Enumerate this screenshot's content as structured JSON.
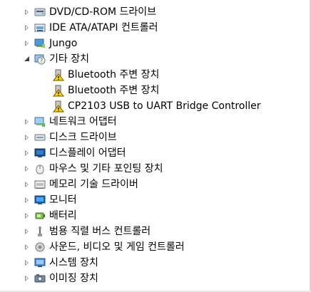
{
  "tree": {
    "items": [
      {
        "label": "DVD/CD-ROM 드라이브",
        "icon": "dvd-drive-icon",
        "state": "collapsed"
      },
      {
        "label": "IDE ATA/ATAPI 컨트롤러",
        "icon": "ide-controller-icon",
        "state": "collapsed"
      },
      {
        "label": "Jungo",
        "icon": "jungo-device-icon",
        "state": "collapsed"
      },
      {
        "label": "기타 장치",
        "icon": "unknown-device-icon",
        "state": "expanded"
      },
      {
        "label": "Bluetooth 주변 장치",
        "icon": "warning-device-icon",
        "state": "leaf"
      },
      {
        "label": "Bluetooth 주변 장치",
        "icon": "warning-device-icon",
        "state": "leaf"
      },
      {
        "label": "CP2103 USB to UART Bridge Controller",
        "icon": "warning-device-icon",
        "state": "leaf"
      },
      {
        "label": "네트워크 어댑터",
        "icon": "network-adapter-icon",
        "state": "collapsed"
      },
      {
        "label": "디스크 드라이브",
        "icon": "disk-drive-icon",
        "state": "collapsed"
      },
      {
        "label": "디스플레이 어댑터",
        "icon": "display-adapter-icon",
        "state": "collapsed"
      },
      {
        "label": "마우스 및 기타 포인팅 장치",
        "icon": "mouse-icon",
        "state": "collapsed"
      },
      {
        "label": "메모리 기술 드라이버",
        "icon": "memory-driver-icon",
        "state": "collapsed"
      },
      {
        "label": "모니터",
        "icon": "monitor-icon",
        "state": "collapsed"
      },
      {
        "label": "배터리",
        "icon": "battery-icon",
        "state": "collapsed"
      },
      {
        "label": "범용 직렬 버스 컨트롤러",
        "icon": "usb-controller-icon",
        "state": "collapsed"
      },
      {
        "label": "사운드, 비디오 및 게임 컨트롤러",
        "icon": "sound-controller-icon",
        "state": "collapsed"
      },
      {
        "label": "시스템 장치",
        "icon": "system-device-icon",
        "state": "collapsed"
      },
      {
        "label": "이미징 장치",
        "icon": "imaging-device-icon",
        "state": "collapsed"
      }
    ]
  }
}
